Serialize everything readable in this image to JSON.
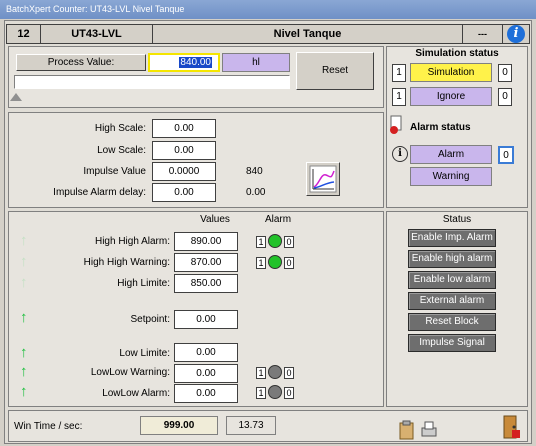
{
  "window": {
    "title": "BatchXpert Counter: UT43-LVL Nivel Tanque"
  },
  "header": {
    "number": "12",
    "tag": "UT43-LVL",
    "description": "Nivel Tanque",
    "dashes": "---"
  },
  "process": {
    "label": "Process Value:",
    "value": "840.00",
    "unit": "hl",
    "reset_label": "Reset"
  },
  "scale": {
    "high_scale_label": "High Scale:",
    "high_scale": "0.00",
    "low_scale_label": "Low Scale:",
    "low_scale": "0.00",
    "impulse_value_label": "Impulse Value",
    "impulse_value": "0.0000",
    "impulse_count": "840",
    "impulse_delay_label": "Impulse Alarm delay:",
    "impulse_delay": "0.00",
    "impulse_delay_value": "0.00"
  },
  "alarms": {
    "values_header": "Values",
    "alarm_header": "Alarm",
    "high_high_alarm_label": "High High Alarm:",
    "high_high_alarm": "890.00",
    "high_high_warning_label": "High High Warning:",
    "high_high_warning": "870.00",
    "high_limit_label": "High Limite:",
    "high_limit": "850.00",
    "setpoint_label": "Setpoint:",
    "setpoint": "0.00",
    "low_limit_label": "Low Limite:",
    "low_limit": "0.00",
    "lowlow_warning_label": "LowLow Warning:",
    "lowlow_warning": "0.00",
    "lowlow_alarm_label": "LowLow Alarm:",
    "lowlow_alarm": "0.00",
    "flag_one": "1",
    "flag_zero": "0",
    "colors": {
      "green": "#22c22a",
      "gray": "#7a7a7a"
    }
  },
  "simulation": {
    "title": "Simulation status",
    "sim_count": "1",
    "sim_label": "Simulation",
    "sim_value": "0",
    "ign_count": "1",
    "ign_label": "Ignore",
    "ign_value": "0",
    "sim_color": "#fff24a",
    "ign_color": "#c9b6ec"
  },
  "alarm_status": {
    "title": "Alarm status",
    "alarm_label": "Alarm",
    "alarm_value": "0",
    "warning_label": "Warning"
  },
  "status": {
    "title": "Status",
    "buttons": [
      "Enable Imp. Alarm",
      "Enable high alarm",
      "Enable low alarm",
      "External alarm",
      "Reset Block",
      "Impulse Signal"
    ]
  },
  "footer": {
    "win_time_label": "Win Time  /  sec:",
    "win_time": "999.00",
    "elapsed": "13.73"
  }
}
